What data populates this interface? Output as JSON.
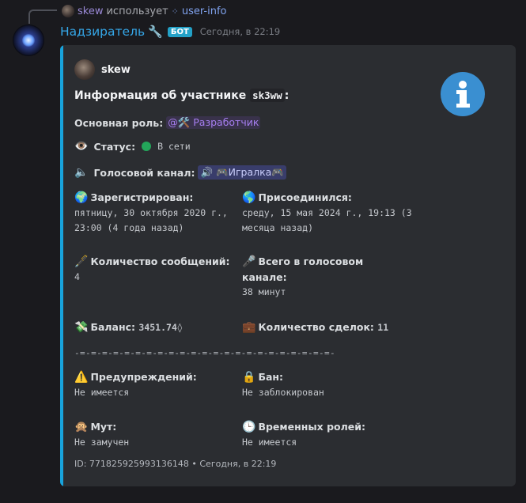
{
  "reply": {
    "username": "skew",
    "uses_text": "использует",
    "command": "user-info"
  },
  "message": {
    "author": "Надзиратель",
    "bot_tag": "БОТ",
    "timestamp": "Сегодня, в 22:19"
  },
  "embed": {
    "accent_color": "#18a3dc",
    "author_name": "skew",
    "thumbnail_icon": "info-icon",
    "title_prefix": "Информация об участнике",
    "title_user": "sk3ww",
    "title_suffix": ":",
    "main_role_label": "Основная роль:",
    "main_role_value": "@🛠️ Разработчик",
    "status_label": "Статус:",
    "status_value": "В сети",
    "voice_label": "Голосовой канал:",
    "voice_channel": "🎮Игралка🎮",
    "fields": {
      "registered_label": "Зарегистрирован:",
      "registered_line1": "пятницу, 30 октября 2020 г.,",
      "registered_line2": "23:00 (4 года назад)",
      "joined_label": "Присоединился:",
      "joined_line1": "среду, 15 мая 2024 г., 19:13 (3",
      "joined_line2": "месяца назад)",
      "messages_label": "Количество сообщений:",
      "messages_value": "4",
      "voice_time_label_1": "Всего в голосовом",
      "voice_time_label_2": "канале:",
      "voice_time_value": "38 минут",
      "balance_label": "Баланс:",
      "balance_value": "3451.74",
      "deals_label": "Количество сделок:",
      "deals_value": "11",
      "separator": "-=-=-=-=-=-=-=-=-=-=-=-=-=-=-=-=-=-=-=-=-=-=-=-",
      "warnings_label": "Предупреждений:",
      "warnings_value": "Не имеется",
      "ban_label": "Бан:",
      "ban_value": "Не заблокирован",
      "mute_label": "Мут:",
      "mute_value": "Не замучен",
      "temp_roles_label": "Временных ролей:",
      "temp_roles_value": "Не имеется"
    },
    "footer": "ID: 771825925993136148 • Сегодня, в 22:19"
  }
}
